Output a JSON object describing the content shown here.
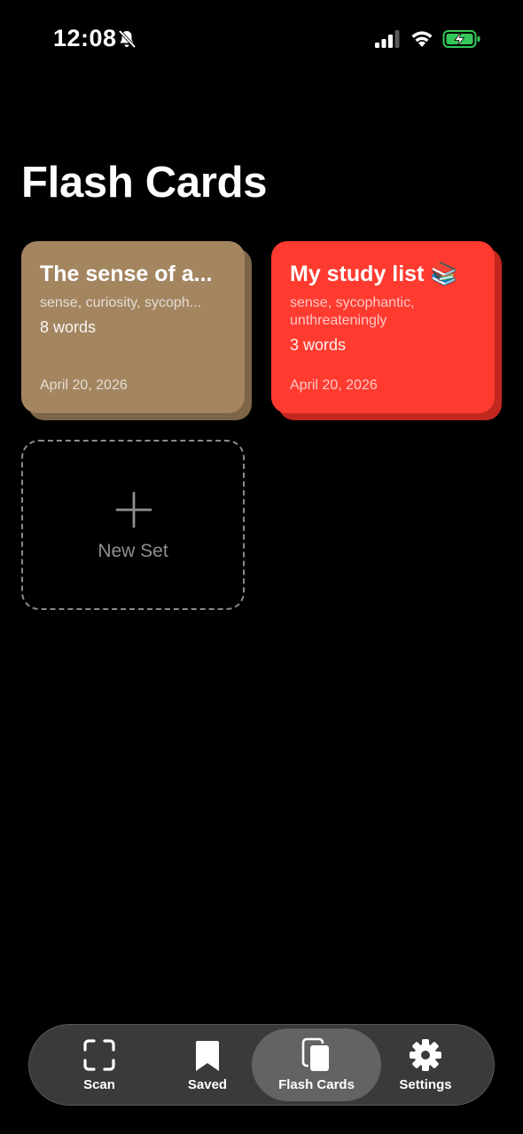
{
  "status_bar": {
    "time": "12:08"
  },
  "page": {
    "title": "Flash Cards"
  },
  "sets": [
    {
      "title": "The sense of a...",
      "words": "sense, curiosity, sycoph...",
      "count": "8 words",
      "date": "April 20, 2026",
      "color": "#a38560",
      "shadow_color": "#7d6547"
    },
    {
      "title": "My study list 📚",
      "words": "sense, sycophantic, unthreateningly",
      "count": "3 words",
      "date": "April 20, 2026",
      "color": "#ff3b30",
      "shadow_color": "#c2281f"
    }
  ],
  "new_set": {
    "label": "New Set"
  },
  "tab_bar": {
    "tabs": [
      {
        "label": "Scan",
        "icon": "scan-icon"
      },
      {
        "label": "Saved",
        "icon": "bookmark-icon"
      },
      {
        "label": "Flash Cards",
        "icon": "cards-icon"
      },
      {
        "label": "Settings",
        "icon": "gear-icon"
      }
    ],
    "active": "Flash Cards"
  }
}
